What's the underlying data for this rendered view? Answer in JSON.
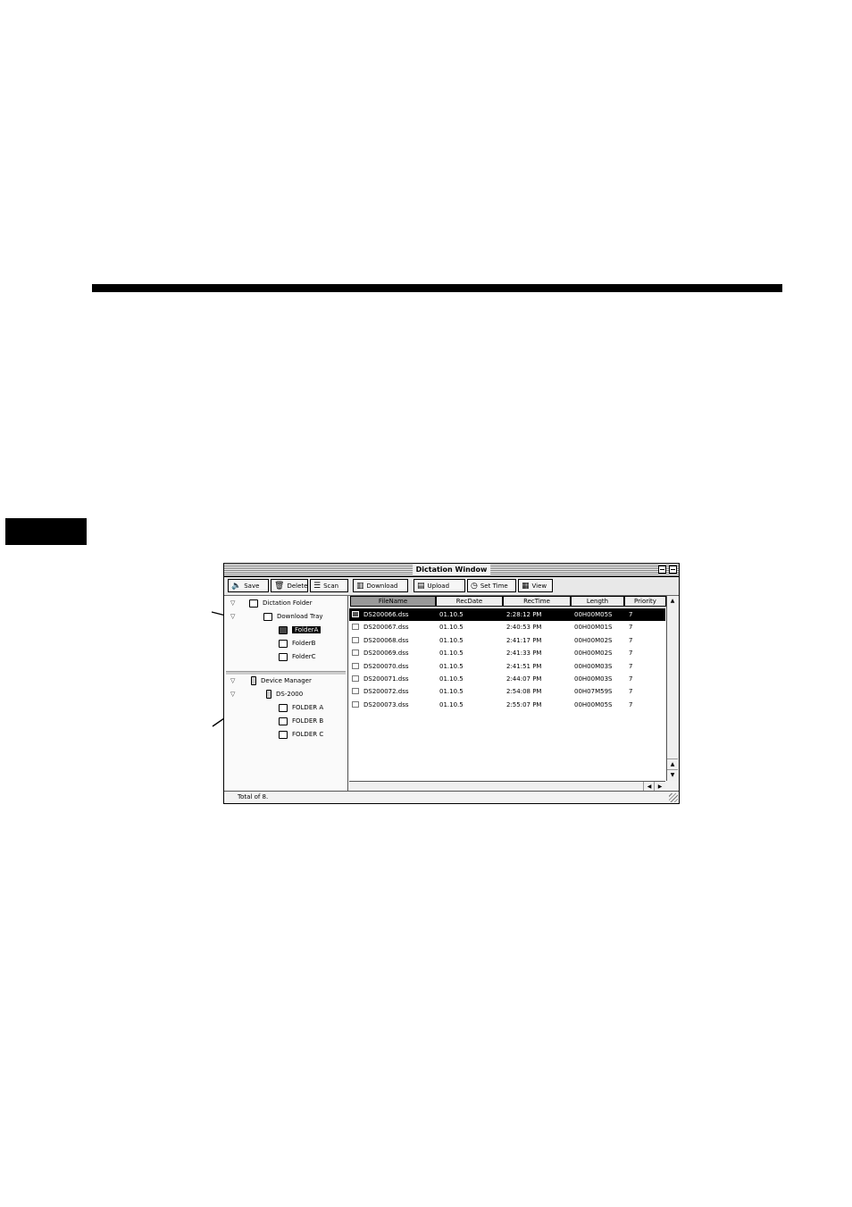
{
  "window": {
    "title": "Dictation Window"
  },
  "toolbar": {
    "buttons": [
      {
        "label": "Save",
        "icon": "speaker-icon"
      },
      {
        "label": "Delete",
        "icon": "trash-icon"
      },
      {
        "label": "Scan",
        "icon": "scan-icon"
      },
      {
        "label": "Download",
        "icon": "download-icon"
      },
      {
        "label": "Upload",
        "icon": "upload-icon"
      },
      {
        "label": "Set Time",
        "icon": "clock-icon"
      },
      {
        "label": "View",
        "icon": "view-icon"
      }
    ]
  },
  "tree": {
    "dictation_folder": "Dictation Folder",
    "download_tray": "Download Tray",
    "folder_a": "FolderA",
    "folder_b": "FolderB",
    "folder_c": "FolderC",
    "device_manager": "Device Manager",
    "device": "DS-2000",
    "dev_folder_a": "FOLDER A",
    "dev_folder_b": "FOLDER B",
    "dev_folder_c": "FOLDER C"
  },
  "table": {
    "columns": [
      "FileName",
      "RecDate",
      "RecTime",
      "Length",
      "Priority"
    ],
    "rows": [
      [
        "DS200066.dss",
        "01.10.5",
        "2:28:12 PM",
        "00H00M05S",
        "7"
      ],
      [
        "DS200067.dss",
        "01.10.5",
        "2:40:53 PM",
        "00H00M01S",
        "7"
      ],
      [
        "DS200068.dss",
        "01.10.5",
        "2:41:17 PM",
        "00H00M02S",
        "7"
      ],
      [
        "DS200069.dss",
        "01.10.5",
        "2:41:33 PM",
        "00H00M02S",
        "7"
      ],
      [
        "DS200070.dss",
        "01.10.5",
        "2:41:51 PM",
        "00H00M03S",
        "7"
      ],
      [
        "DS200071.dss",
        "01.10.5",
        "2:44:07 PM",
        "00H00M03S",
        "7"
      ],
      [
        "DS200072.dss",
        "01.10.5",
        "2:54:08 PM",
        "00H07M59S",
        "7"
      ],
      [
        "DS200073.dss",
        "01.10.5",
        "2:55:07 PM",
        "00H00M05S",
        "7"
      ]
    ]
  },
  "status": {
    "text": "Total of 8."
  }
}
